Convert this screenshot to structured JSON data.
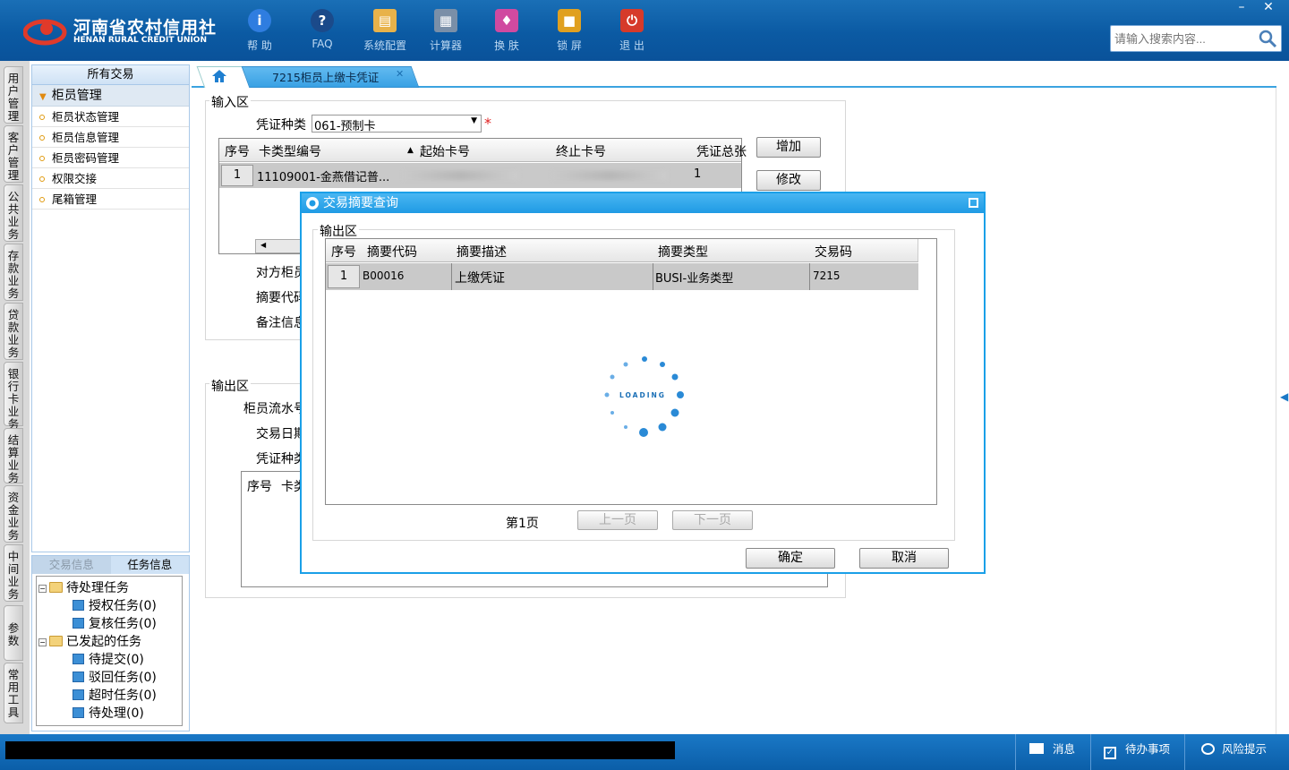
{
  "app": {
    "logo_cn": "河南省农村信用社",
    "logo_en": "HENAN RURAL CREDIT UNION"
  },
  "toolbar": [
    {
      "label": "帮 助",
      "icon": "info-icon",
      "color": "#2f7de0"
    },
    {
      "label": "FAQ",
      "icon": "question-icon",
      "color": "#1b4a8a"
    },
    {
      "label": "系统配置",
      "icon": "toolbox-icon",
      "color": "#e8b24a"
    },
    {
      "label": "计算器",
      "icon": "calculator-icon",
      "color": "#7a8fa8"
    },
    {
      "label": "换 肤",
      "icon": "shirt-icon",
      "color": "#d04aa0"
    },
    {
      "label": "锁 屏",
      "icon": "lock-icon",
      "color": "#e0a020"
    },
    {
      "label": "退 出",
      "icon": "power-icon",
      "color": "#d63a2a"
    }
  ],
  "window": {
    "minimize": "–",
    "close": "✕"
  },
  "search": {
    "placeholder": "请输入搜索内容..."
  },
  "side_tabs": [
    "用户管理",
    "客户管理",
    "公共业务",
    "存款业务",
    "贷款业务",
    "银行卡业务",
    "结算业务",
    "资金业务",
    "中间业务",
    "参数",
    "常用工具"
  ],
  "menu": {
    "header": "所有交易",
    "group": "柜员管理",
    "items": [
      "柜员状态管理",
      "柜员信息管理",
      "柜员密码管理",
      "权限交接",
      "尾箱管理"
    ]
  },
  "task_panel": {
    "tab_trade": "交易信息",
    "tab_task": "任务信息",
    "tree": {
      "pending": "待处理任务",
      "auth": "授权任务(0)",
      "review": "复核任务(0)",
      "initiated": "已发起的任务",
      "submit": "待提交(0)",
      "rejected": "驳回任务(0)",
      "timeout": "超时任务(0)",
      "todo": "待处理(0)"
    }
  },
  "tab": {
    "active": "7215柜员上缴卡凭证"
  },
  "form": {
    "input_legend": "输入区",
    "voucher_type_label": "凭证种类",
    "voucher_type_value": "061-预制卡",
    "required": "*",
    "columns": [
      "序号",
      "卡类型编号",
      "起始卡号",
      "终止卡号",
      "凭证总张"
    ],
    "row": {
      "no": "1",
      "card_type": "11109001-金燕借记普...",
      "total": "1"
    },
    "add": "增加",
    "modify": "修改",
    "counterpart_label": "对方柜员",
    "summary_code_label": "摘要代码",
    "note_label": "备注信息",
    "output_legend": "输出区",
    "teller_serial_label": "柜员流水号",
    "trade_date_label": "交易日期",
    "voucher_type2_label": "凭证种类",
    "out_cols": [
      "序号",
      "卡类"
    ]
  },
  "dialog": {
    "title": "交易摘要查询",
    "legend": "输出区",
    "columns": [
      "序号",
      "摘要代码",
      "摘要描述",
      "摘要类型",
      "交易码"
    ],
    "row": {
      "no": "1",
      "code": "B00016",
      "desc": "上缴凭证",
      "type": "BUSI-业务类型",
      "trade": "7215"
    },
    "loading": "LOADING",
    "page": "第1页",
    "prev": "上一页",
    "next": "下一页",
    "ok": "确定",
    "cancel": "取消"
  },
  "status": {
    "message": "消息",
    "todo": "待办事项",
    "risk": "风险提示"
  }
}
